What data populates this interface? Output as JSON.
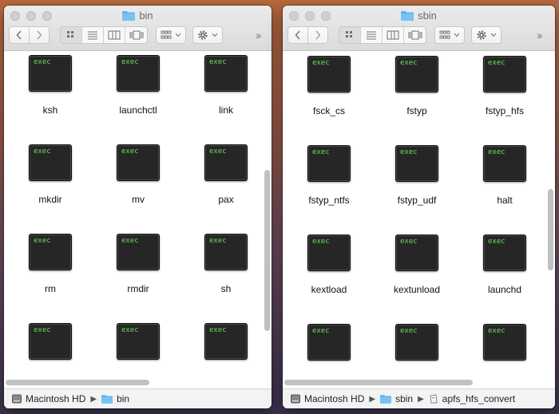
{
  "windows": [
    {
      "id": "left",
      "title": "bin",
      "items": [
        "ksh",
        "launchctl",
        "link",
        "mkdir",
        "mv",
        "pax",
        "rm",
        "rmdir",
        "sh",
        "",
        "",
        ""
      ],
      "path": [
        "Macintosh HD",
        "bin"
      ]
    },
    {
      "id": "right",
      "title": "sbin",
      "items": [
        "fsck_cs",
        "fstyp",
        "fstyp_hfs",
        "fstyp_ntfs",
        "fstyp_udf",
        "halt",
        "kextload",
        "kextunload",
        "launchd",
        "",
        "",
        ""
      ],
      "path": [
        "Macintosh HD",
        "sbin",
        "apfs_hfs_convert"
      ]
    }
  ],
  "icon_badge": "exec",
  "icons": {
    "file": "exec-file-icon",
    "folder": "folder-icon",
    "disk": "hard-disk-icon",
    "back": "chevron-left-icon",
    "forward": "chevron-right-icon",
    "gear": "gear-icon"
  },
  "colors": {
    "folder": "#5ab2ea",
    "exec_text": "#6fda62",
    "icon_bg": "#262626"
  }
}
